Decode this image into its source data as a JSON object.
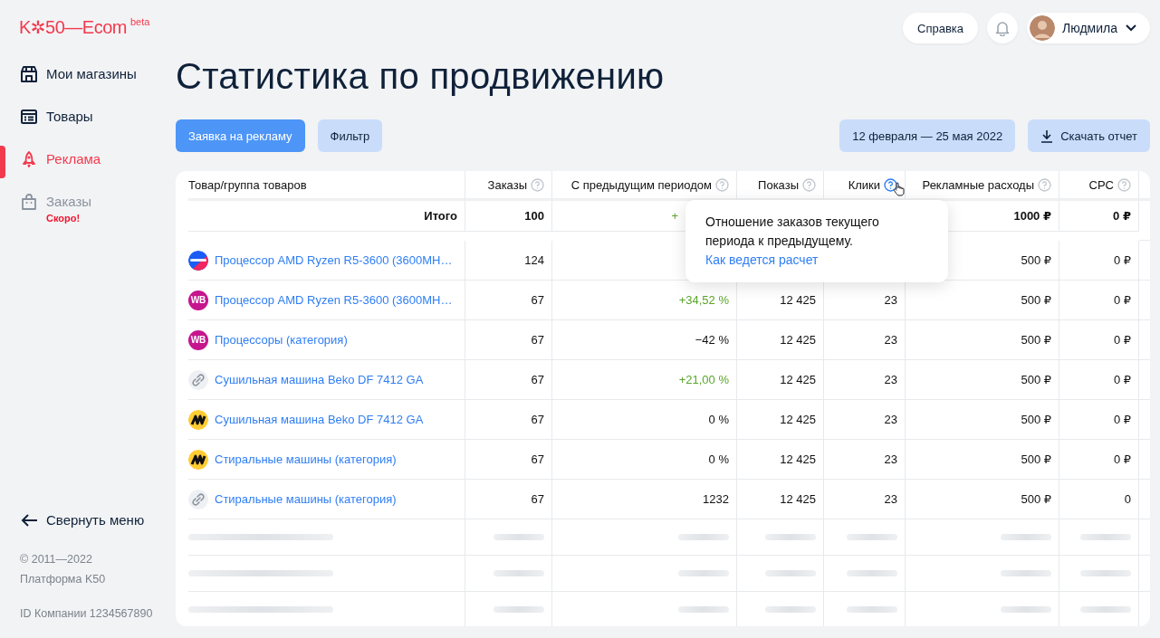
{
  "logo": {
    "text": "K✲50—Ecom",
    "badge": "beta"
  },
  "sidebar": {
    "items": [
      {
        "label": "Мои магазины",
        "selected": false,
        "disabled": false
      },
      {
        "label": "Товары",
        "selected": false,
        "disabled": false
      },
      {
        "label": "Реклама",
        "selected": true,
        "disabled": false
      },
      {
        "label": "Заказы",
        "selected": false,
        "disabled": true,
        "badge": "Скоро!"
      }
    ],
    "collapse": "Свернуть меню",
    "copyright": "© 2011—2022",
    "platform": "Платформа K50",
    "company_id": "ID Компании 1234567890"
  },
  "header": {
    "help": "Справка",
    "user": "Людмила"
  },
  "title": "Статистика по продвижению",
  "toolbar": {
    "request": "Заявка на рекламу",
    "filter": "Фильтр",
    "period": "12 февраля — 25 мая 2022",
    "download": "Скачать отчет"
  },
  "table": {
    "columns": [
      {
        "label": "Товар/группа товаров",
        "help": false
      },
      {
        "label": "Заказы",
        "help": true,
        "active": false
      },
      {
        "label": "С предыдущим периодом",
        "help": true,
        "active": false
      },
      {
        "label": "Показы",
        "help": true,
        "active": false
      },
      {
        "label": "Клики",
        "help": true,
        "active": true
      },
      {
        "label": "Рекламные расходы",
        "help": true,
        "active": false
      },
      {
        "label": "CPC",
        "help": true,
        "active": false
      }
    ],
    "total": {
      "label": "Итого",
      "orders": "100",
      "change": "+",
      "change_up": true,
      "change_cut": true,
      "spend": "1000 ₽",
      "cpc": "0 ₽"
    },
    "rows": [
      {
        "kind": "ozon",
        "name": "Процессор AMD Ryzen R5-3600 (3600MH…",
        "orders": "124",
        "spend": "500 ₽",
        "cpc": "0 ₽"
      },
      {
        "kind": "wb",
        "logo": "WB",
        "name": "Процессор AMD Ryzen R5-3600 (3600MH…",
        "orders": "67",
        "change": "+34,52 %",
        "change_up": true,
        "shows": "12 425",
        "clicks": "23",
        "spend": "500 ₽",
        "cpc": "0 ₽"
      },
      {
        "kind": "wb",
        "logo": "WB",
        "name": "Процессоры (категория)",
        "orders": "67",
        "change": "−42 %",
        "change_up": false,
        "shows": "12 425",
        "clicks": "23",
        "spend": "500 ₽",
        "cpc": "0 ₽"
      },
      {
        "kind": "link",
        "name": "Сушильная машина Beko DF 7412 GA",
        "orders": "67",
        "change": "+21,00 %",
        "change_up": true,
        "shows": "12 425",
        "clicks": "23",
        "spend": "500 ₽",
        "cpc": "0 ₽"
      },
      {
        "kind": "ym",
        "name": "Сушильная машина Beko DF 7412 GA",
        "orders": "67",
        "change": "0 %",
        "change_up": false,
        "shows": "12 425",
        "clicks": "23",
        "spend": "500 ₽",
        "cpc": "0 ₽"
      },
      {
        "kind": "ym",
        "name": "Стиральные машины (категория)",
        "orders": "67",
        "change": "0 %",
        "change_up": false,
        "shows": "12 425",
        "clicks": "23",
        "spend": "500 ₽",
        "cpc": "0 ₽"
      },
      {
        "kind": "link",
        "name": "Стиральные машины (категория)",
        "orders": "67",
        "change": "1232",
        "change_up": false,
        "shows": "12 425",
        "clicks": "23",
        "spend": "500 ₽",
        "cpc": "0"
      }
    ],
    "loading_rows": [
      {
        "kind": "skeleton"
      },
      {
        "kind": "skeleton"
      },
      {
        "kind": "skeleton"
      }
    ]
  },
  "tooltip": {
    "text": "Отношение заказов текущего периода к предыдущему.",
    "link": "Как ведется расчет"
  }
}
